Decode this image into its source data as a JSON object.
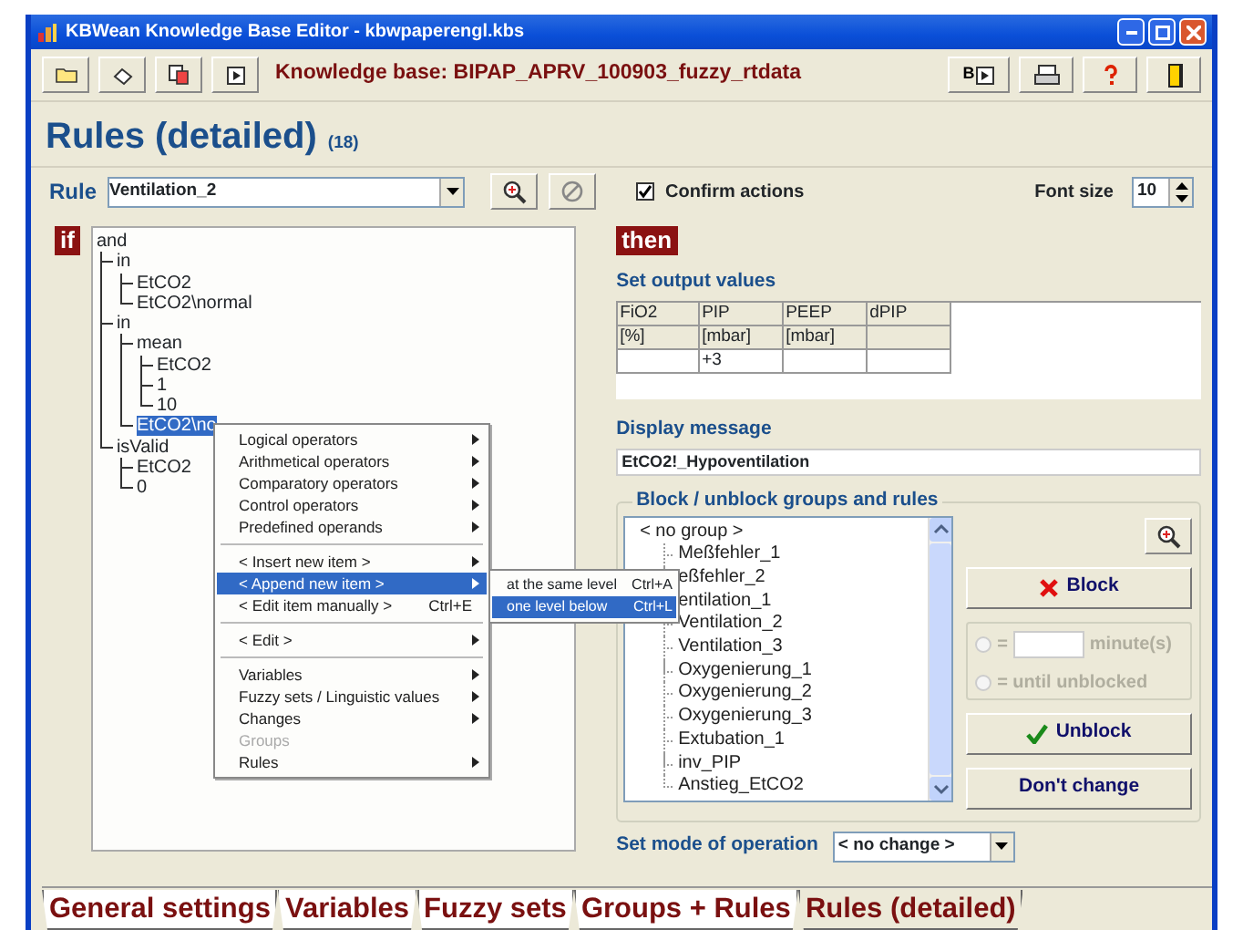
{
  "window": {
    "title": "KBWean Knowledge Base Editor - kbwpaperengl.kbs"
  },
  "toolbar": {
    "knowledge_base": "Knowledge base: BIPAP_APRV_100903_fuzzy_rtdata",
    "b_label": "B"
  },
  "heading": {
    "title": "Rules (detailed)",
    "count": "(18)"
  },
  "rule_bar": {
    "label": "Rule",
    "value": "Ventilation_2",
    "confirm_label": "Confirm actions",
    "confirm_checked": true,
    "font_size_label": "Font size",
    "font_size": "10"
  },
  "condition": {
    "badge": "if",
    "tree": [
      {
        "label": "and",
        "selected": false,
        "children": [
          {
            "label": "in",
            "selected": false,
            "children": [
              {
                "label": "EtCO2",
                "selected": false
              },
              {
                "label": "EtCO2\\normal",
                "selected": false
              }
            ]
          },
          {
            "label": "in",
            "selected": false,
            "children": [
              {
                "label": "mean",
                "selected": false,
                "children": [
                  {
                    "label": "EtCO2",
                    "selected": false
                  },
                  {
                    "label": "1",
                    "selected": false
                  },
                  {
                    "label": "10",
                    "selected": false
                  }
                ]
              },
              {
                "label": "EtCO2\\no",
                "selected": true
              }
            ]
          },
          {
            "label": "isValid",
            "selected": false,
            "children": [
              {
                "label": "EtCO2",
                "selected": false
              },
              {
                "label": "0",
                "selected": false
              }
            ]
          }
        ]
      }
    ]
  },
  "consequence": {
    "badge": "then",
    "output_title": "Set output values",
    "output_table": {
      "columns": [
        {
          "header": "FiO2",
          "unit": "[%]"
        },
        {
          "header": "PIP",
          "unit": "[mbar]",
          "value": "+3"
        },
        {
          "header": "PEEP",
          "unit": "[mbar]"
        },
        {
          "header": "dPIP"
        }
      ]
    },
    "message_title": "Display message",
    "message": "EtCO2!_Hypoventilation",
    "block_title": "Block / unblock groups and rules",
    "groups": [
      {
        "label": "< no group >",
        "children": [
          {
            "label": "Meßfehler_1"
          },
          {
            "label": "eßfehler_2"
          },
          {
            "label": "entilation_1"
          },
          {
            "label": "Ventilation_2"
          },
          {
            "label": "Ventilation_3"
          },
          {
            "label": "Oxygenierung_1"
          },
          {
            "label": "Oxygenierung_2"
          },
          {
            "label": "Oxygenierung_3"
          },
          {
            "label": "Extubation_1"
          },
          {
            "label": "inv_PIP"
          },
          {
            "label": "Anstieg_EtCO2"
          }
        ]
      }
    ],
    "block_button": "Block",
    "block_options": {
      "disabled": true,
      "options": [
        {
          "prefix": "=",
          "suffix": "minute(s)",
          "kind": "minutes",
          "selected": false
        },
        {
          "prefix": "= until unblocked",
          "kind": "until",
          "selected": false
        }
      ]
    },
    "unblock_button": "Unblock",
    "dont_change_button": "Don't change",
    "mode_label": "Set mode of operation",
    "mode_value": "< no change >"
  },
  "context_menu": {
    "items": [
      {
        "kind": "item",
        "label": "Logical operators",
        "submenu": true,
        "selected": false,
        "disabled": false
      },
      {
        "kind": "item",
        "label": "Arithmetical operators",
        "submenu": true,
        "selected": false,
        "disabled": false
      },
      {
        "kind": "item",
        "label": "Comparatory operators",
        "submenu": true,
        "selected": false,
        "disabled": false
      },
      {
        "kind": "item",
        "label": "Control operators",
        "submenu": true,
        "selected": false,
        "disabled": false
      },
      {
        "kind": "item",
        "label": "Predefined operands",
        "submenu": true,
        "selected": false,
        "disabled": false
      },
      {
        "kind": "separator"
      },
      {
        "kind": "item",
        "label": "< Insert new item >",
        "submenu": true,
        "selected": false,
        "disabled": false
      },
      {
        "kind": "item",
        "label": "< Append new item >",
        "submenu": true,
        "selected": true,
        "disabled": false
      },
      {
        "kind": "item",
        "label": "< Edit item manually >",
        "shortcut": "Ctrl+E",
        "submenu": false,
        "selected": false,
        "disabled": false
      },
      {
        "kind": "separator"
      },
      {
        "kind": "item",
        "label": "< Edit >",
        "submenu": true,
        "selected": false,
        "disabled": false
      },
      {
        "kind": "separator"
      },
      {
        "kind": "item",
        "label": "Variables",
        "submenu": true,
        "selected": false,
        "disabled": false
      },
      {
        "kind": "item",
        "label": "Fuzzy sets / Linguistic values",
        "submenu": true,
        "selected": false,
        "disabled": false
      },
      {
        "kind": "item",
        "label": "Changes",
        "submenu": true,
        "selected": false,
        "disabled": false
      },
      {
        "kind": "item",
        "label": "Groups",
        "submenu": false,
        "selected": false,
        "disabled": true
      },
      {
        "kind": "item",
        "label": "Rules",
        "submenu": true,
        "selected": false,
        "disabled": false
      }
    ]
  },
  "submenu": {
    "items": [
      {
        "label": "at the same level",
        "shortcut": "Ctrl+A",
        "selected": false
      },
      {
        "label": "one level below",
        "shortcut": "Ctrl+L",
        "selected": true
      }
    ]
  },
  "tabs": [
    {
      "label": "General settings",
      "selected": false
    },
    {
      "label": "Variables",
      "selected": false
    },
    {
      "label": "Fuzzy sets",
      "selected": false
    },
    {
      "label": "Groups + Rules",
      "selected": false
    },
    {
      "label": "Rules (detailed)",
      "selected": true
    }
  ]
}
